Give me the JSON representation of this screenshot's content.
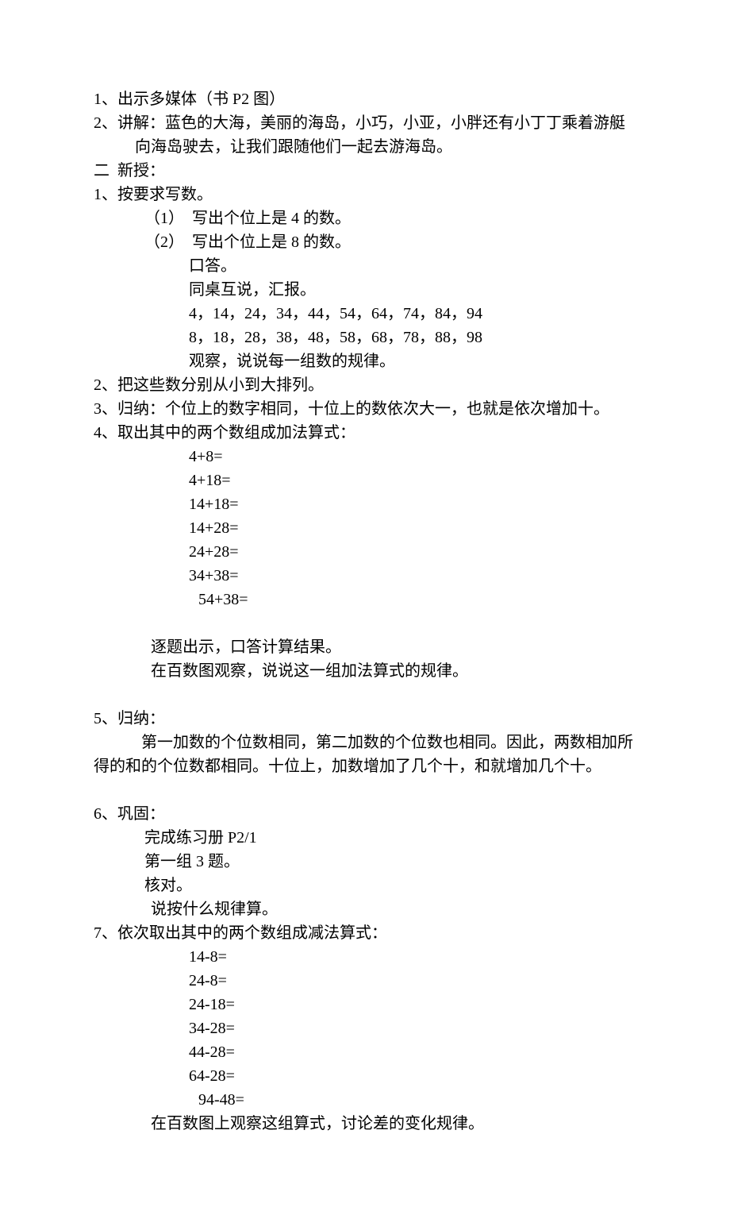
{
  "lines": {
    "l1": "1、出示多媒体（书 P2 图）",
    "l2": "2、讲解：蓝色的大海，美丽的海岛，小巧，小亚，小胖还有小丁丁乘着游艇向海岛驶去，让我们跟随他们一起去游海岛。",
    "l3": "二  新授：",
    "l4": "1、按要求写数。",
    "l5": "（1）  写出个位上是 4 的数。",
    "l6": "（2）  写出个位上是 8 的数。",
    "l7": "口答。",
    "l8": "同桌互说，汇报。",
    "l9": "4，14，24，34，44，54，64，74，84，94",
    "l10": "8，18，28，38，48，58，68，78，88，98",
    "l11": "观察，说说每一组数的规律。",
    "l12": "2、把这些数分别从小到大排列。",
    "l13": "3、归纳：个位上的数字相同，十位上的数依次大一，也就是依次增加十。",
    "l14": "4、取出其中的两个数组成加法算式：",
    "e1": "4+8=",
    "e2": "4+18=",
    "e3": "14+18=",
    "e4": "14+28=",
    "e5": "24+28=",
    "e6": "34+38=",
    "e7": "54+38=",
    "l15": "逐题出示，口答计算结果。",
    "l16": "在百数图观察，说说这一组加法算式的规律。",
    "l17": "5、归纳：",
    "l18": "第一加数的个位数相同，第二加数的个位数也相同。因此，两数相加所得的和的个位数都相同。十位上，加数增加了几个十，和就增加几个十。",
    "l19": "6、巩固：",
    "l20": "完成练习册 P2/1",
    "l21": "第一组 3 题。",
    "l22": "核对。",
    "l23": "说按什么规律算。",
    "l24": "7、依次取出其中的两个数组成减法算式：",
    "s1": "14-8=",
    "s2": "24-8=",
    "s3": "24-18=",
    "s4": "34-28=",
    "s5": "44-28=",
    "s6": "64-28=",
    "s7": "94-48=",
    "l25": "在百数图上观察这组算式，讨论差的变化规律。"
  }
}
